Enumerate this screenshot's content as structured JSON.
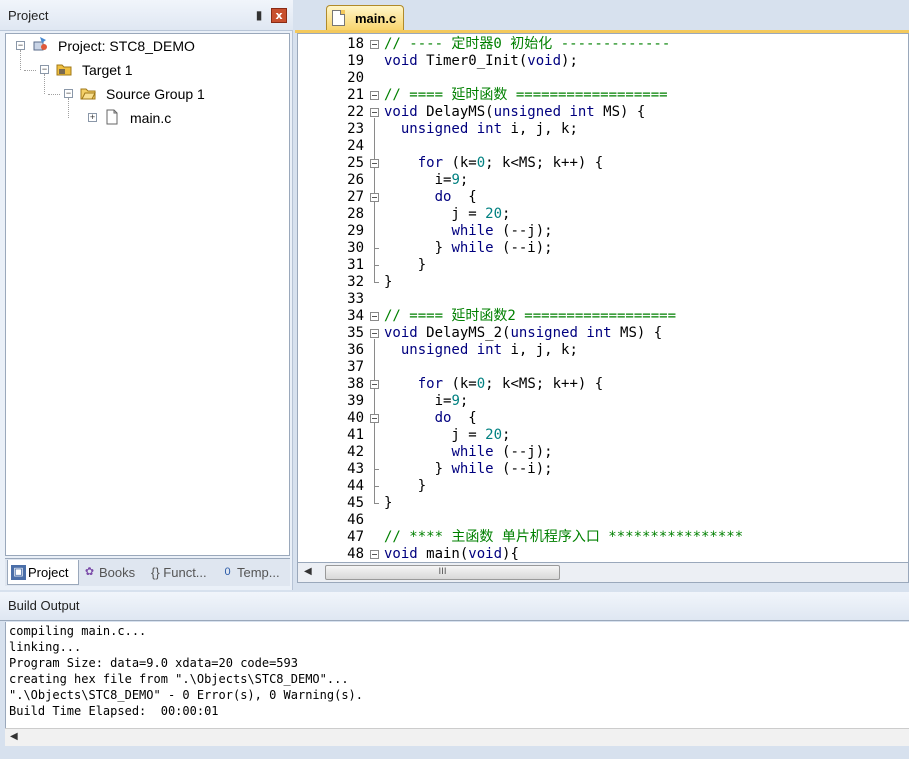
{
  "project_panel": {
    "title": "Project",
    "pin_glyph": "▮",
    "close_glyph": "x",
    "tree": {
      "project": "Project: STC8_DEMO",
      "target": "Target 1",
      "group": "Source Group 1",
      "file": "main.c"
    },
    "tabs": [
      {
        "label": "Project",
        "icon": "project-icon"
      },
      {
        "label": "Books",
        "icon": "books-icon"
      },
      {
        "label": "{} Funct...",
        "icon": "functions-icon"
      },
      {
        "label": "Temp...",
        "icon": "templates-icon"
      }
    ]
  },
  "editor": {
    "tab_label": "main.c",
    "scroll_thumb_grip": "III",
    "lines": [
      {
        "n": "18",
        "code": "// ---- 定时器0 初始化 -------------"
      },
      {
        "n": "19",
        "code": "void Timer0_Init(void);"
      },
      {
        "n": "20",
        "code": ""
      },
      {
        "n": "21",
        "code": "// ==== 延时函数 =================="
      },
      {
        "n": "22",
        "code": "void DelayMS(unsigned int MS) {"
      },
      {
        "n": "23",
        "code": "  unsigned int i, j, k;"
      },
      {
        "n": "24",
        "code": ""
      },
      {
        "n": "25",
        "code": "    for (k=0; k<MS; k++) {"
      },
      {
        "n": "26",
        "code": "      i=9;"
      },
      {
        "n": "27",
        "code": "      do  {"
      },
      {
        "n": "28",
        "code": "        j = 20;"
      },
      {
        "n": "29",
        "code": "        while (--j);"
      },
      {
        "n": "30",
        "code": "      } while (--i);"
      },
      {
        "n": "31",
        "code": "    }"
      },
      {
        "n": "32",
        "code": "}"
      },
      {
        "n": "33",
        "code": ""
      },
      {
        "n": "34",
        "code": "// ==== 延时函数2 =================="
      },
      {
        "n": "35",
        "code": "void DelayMS_2(unsigned int MS) {"
      },
      {
        "n": "36",
        "code": "  unsigned int i, j, k;"
      },
      {
        "n": "37",
        "code": ""
      },
      {
        "n": "38",
        "code": "    for (k=0; k<MS; k++) {"
      },
      {
        "n": "39",
        "code": "      i=9;"
      },
      {
        "n": "40",
        "code": "      do  {"
      },
      {
        "n": "41",
        "code": "        j = 20;"
      },
      {
        "n": "42",
        "code": "        while (--j);"
      },
      {
        "n": "43",
        "code": "      } while (--i);"
      },
      {
        "n": "44",
        "code": "    }"
      },
      {
        "n": "45",
        "code": "}"
      },
      {
        "n": "46",
        "code": ""
      },
      {
        "n": "47",
        "code": "// **** 主函数 单片机程序入口 ****************"
      },
      {
        "n": "48",
        "code": "void main(void){"
      }
    ]
  },
  "build_output": {
    "title": "Build Output",
    "lines": [
      "compiling main.c...",
      "linking...",
      "Program Size: data=9.0 xdata=20 code=593",
      "creating hex file from \".\\Objects\\STC8_DEMO\"...",
      "\".\\Objects\\STC8_DEMO\" - 0 Error(s), 0 Warning(s).",
      "Build Time Elapsed:  00:00:01"
    ]
  },
  "colors": {
    "keyword": "#00007f",
    "comment": "#008000",
    "number": "#008080",
    "tab_active": "#f8d36a"
  }
}
